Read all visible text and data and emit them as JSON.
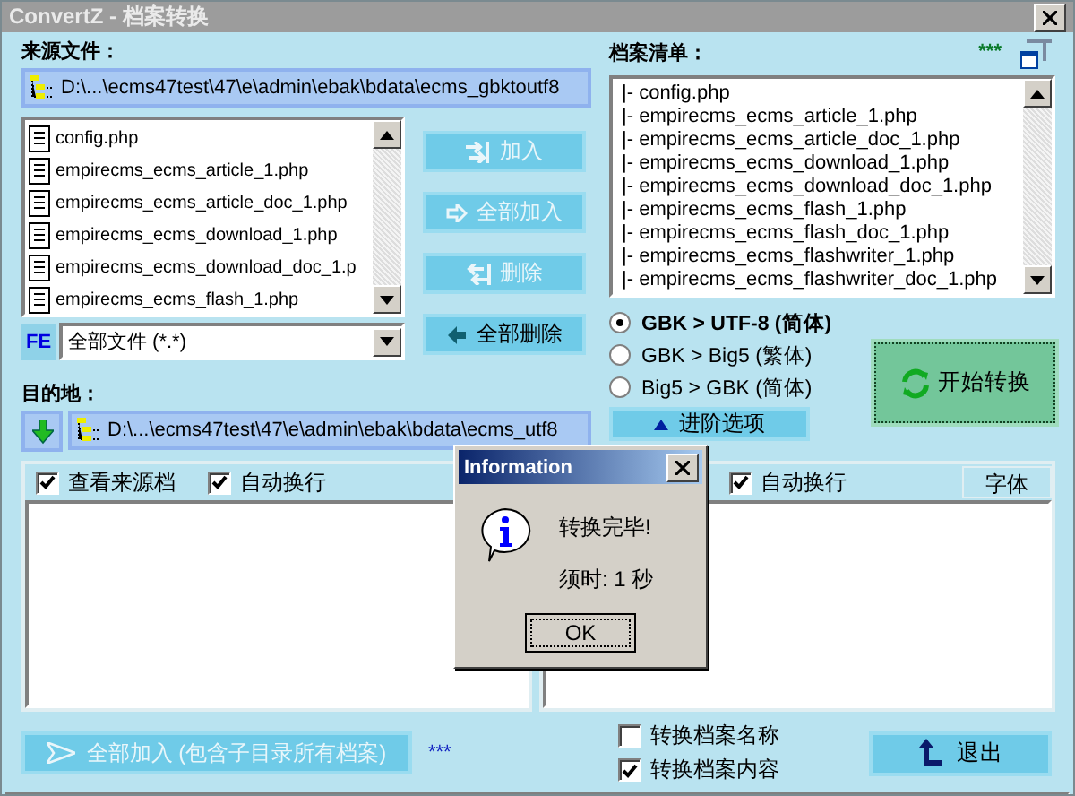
{
  "window": {
    "title": "ConvertZ - 档案转换"
  },
  "source": {
    "label": "来源文件：",
    "path": "D:\\...\\ecms47test\\47\\e\\admin\\ebak\\bdata\\ecms_gbktoutf8",
    "files": [
      "config.php",
      "empirecms_ecms_article_1.php",
      "empirecms_ecms_article_doc_1.php",
      "empirecms_ecms_download_1.php",
      "empirecms_ecms_download_doc_1.p",
      "empirecms_ecms_flash_1.php"
    ],
    "filter_badge": "FE",
    "filter": "全部文件 (*.*)"
  },
  "actions": [
    {
      "kind": "add",
      "label": "加入",
      "disabled": true
    },
    {
      "kind": "add_all",
      "label": "全部加入",
      "disabled": true
    },
    {
      "kind": "remove",
      "label": "删除",
      "disabled": true
    },
    {
      "kind": "remove_all",
      "label": "全部删除",
      "disabled": false
    }
  ],
  "destination": {
    "label": "目的地：",
    "path": "D:\\...\\ecms47test\\47\\e\\admin\\ebak\\bdata\\ecms_utf8"
  },
  "file_list": {
    "label": "档案清单：",
    "marker": "***",
    "items": [
      "|-  config.php",
      "|-  empirecms_ecms_article_1.php",
      "|-  empirecms_ecms_article_doc_1.php",
      "|-  empirecms_ecms_download_1.php",
      "|-  empirecms_ecms_download_doc_1.php",
      "|-  empirecms_ecms_flash_1.php",
      "|-  empirecms_ecms_flash_doc_1.php",
      "|-  empirecms_ecms_flashwriter_1.php",
      "|-  empirecms_ecms_flashwriter_doc_1.php"
    ]
  },
  "conversions": [
    {
      "label": "GBK > UTF-8 (简体)",
      "selected": true
    },
    {
      "label": "GBK > Big5 (繁体)",
      "selected": false
    },
    {
      "label": "Big5 > GBK (简体)",
      "selected": false
    }
  ],
  "advanced_button": "进阶选项",
  "start_button": "开始转换",
  "left_panel": {
    "checkboxes": [
      {
        "label": "查看来源档",
        "checked": true
      },
      {
        "label": "自动换行",
        "checked": true
      }
    ]
  },
  "right_panel": {
    "checkboxes": [
      {
        "label": "自动换行",
        "checked": true
      }
    ],
    "font_button": "字体"
  },
  "bottom": {
    "add_all_button": {
      "label": "全部加入 (包含子目录所有档案)",
      "disabled": true
    },
    "marker": "***",
    "options": [
      {
        "label": "转换档案名称",
        "checked": false
      },
      {
        "label": "转换档案内容",
        "checked": true
      }
    ],
    "exit_button": "退出"
  },
  "dialog": {
    "title": "Information",
    "message": "转换完毕!",
    "detail": "须时: 1 秒",
    "ok": "OK"
  }
}
